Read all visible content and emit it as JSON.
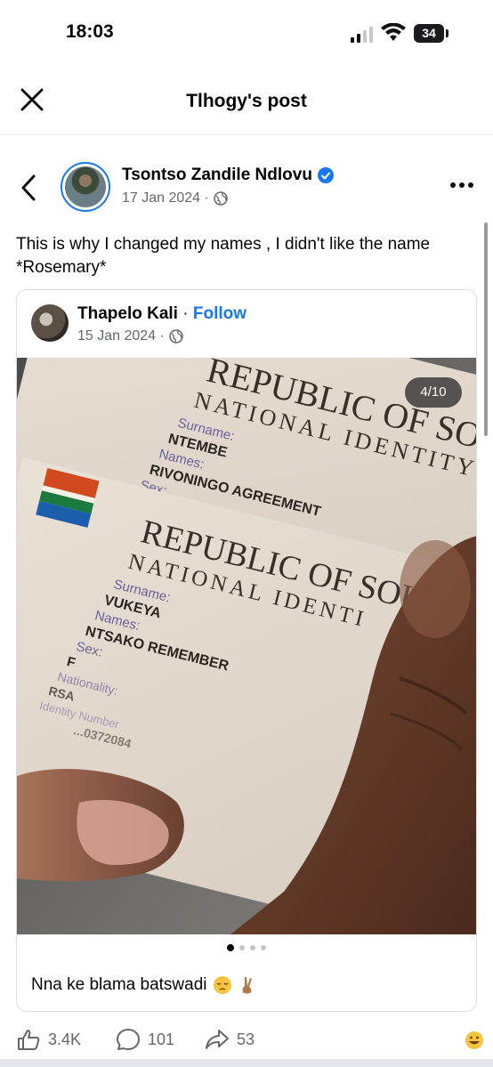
{
  "status_bar": {
    "time": "18:03",
    "battery": "34"
  },
  "header": {
    "title": "Tlhogy's post"
  },
  "post": {
    "author": "Tsontso Zandile Ndlovu",
    "date": "17 Jan 2024 ·",
    "caption": "This is why I changed my names , I didn't like the name *Rosemary*"
  },
  "shared_post": {
    "author": "Thapelo Kali",
    "separator": " · ",
    "follow_label": "Follow",
    "date": "15 Jan 2024 ·",
    "photo_counter": "4/10",
    "caption": "Nna ke blama batswadi",
    "id_card_1": {
      "heading_1": "REPUBLIC OF SOUTH",
      "heading_2": "NATIONAL IDENTITY",
      "surname_label": "Surname:",
      "surname": "NTEMBE",
      "names_label": "Names:",
      "names": "RIVONINGO AGREEMENT",
      "sex_label": "Sex:"
    },
    "id_card_2": {
      "heading_1": "REPUBLIC OF SOUT",
      "heading_2": "NATIONAL IDENTI",
      "surname_label": "Surname:",
      "surname": "VUKEYA",
      "names_label": "Names:",
      "names": "NTSAKO REMEMBER",
      "sex_label": "Sex:",
      "sex": "F",
      "nationality_label": "Nationality:",
      "nationality": "RSA",
      "id_number_label": "Identity Number",
      "id_number": "...0372084"
    }
  },
  "actions": {
    "likes": "3.4K",
    "comments": "101",
    "shares": "53"
  },
  "colors": {
    "accent": "#1877f2",
    "secondary_text": "#65676b"
  }
}
